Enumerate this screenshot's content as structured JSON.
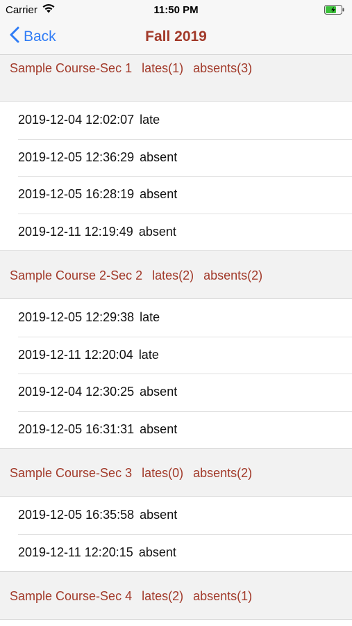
{
  "status_bar": {
    "carrier": "Carrier",
    "time": "11:50 PM",
    "wifi_icon": "wifi-icon",
    "battery_icon": "battery-charging-icon"
  },
  "nav": {
    "back_label": "Back",
    "back_icon": "chevron-left-icon",
    "title": "Fall 2019"
  },
  "colors": {
    "accent": "#a23a2a",
    "link": "#2f7cf6"
  },
  "sections": [
    {
      "course": "Sample Course-Sec 1",
      "lates": "lates(1)",
      "absents": "absents(3)",
      "records": [
        {
          "timestamp": "2019-12-04 12:02:07",
          "status": "late"
        },
        {
          "timestamp": "2019-12-05 12:36:29",
          "status": "absent"
        },
        {
          "timestamp": "2019-12-05 16:28:19",
          "status": "absent"
        },
        {
          "timestamp": "2019-12-11 12:19:49",
          "status": "absent"
        }
      ]
    },
    {
      "course": "Sample Course 2-Sec 2",
      "lates": "lates(2)",
      "absents": "absents(2)",
      "records": [
        {
          "timestamp": "2019-12-05 12:29:38",
          "status": "late"
        },
        {
          "timestamp": "2019-12-11 12:20:04",
          "status": "late"
        },
        {
          "timestamp": "2019-12-04 12:30:25",
          "status": "absent"
        },
        {
          "timestamp": "2019-12-05 16:31:31",
          "status": "absent"
        }
      ]
    },
    {
      "course": "Sample Course-Sec 3",
      "lates": "lates(0)",
      "absents": "absents(2)",
      "records": [
        {
          "timestamp": "2019-12-05 16:35:58",
          "status": "absent"
        },
        {
          "timestamp": "2019-12-11 12:20:15",
          "status": "absent"
        }
      ]
    },
    {
      "course": "Sample Course-Sec 4",
      "lates": "lates(2)",
      "absents": "absents(1)",
      "records": []
    }
  ]
}
